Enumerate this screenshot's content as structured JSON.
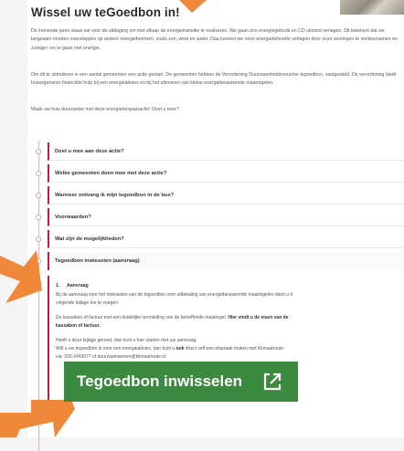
{
  "page": {
    "title": "Wissel uw teGoedbon in!",
    "intro": "De komende jaren staan we voor de uitdaging om met elkaar de energietransitie te realiseren. We gaan ons energiegebruik en CO uitstoot verlagen. Dit betekent dat we langzaam moeten overstappen op andere energiebronnen, zoals zon, wind en water. Daa kunnen we onze energiebehoefte verlagen door onze woningen te verduurzamen en zuiniger om te gaan met energie.",
    "paragraph2": "Om dit te stimuleren is een aantal gemeenten een actie gestart. De gemeenten hebben de Verordening Duurzaamheidsvoucher tegoedbon, vastgesteld. De verordening biedt huiseigenaren financiële hulp bij een energieadvies en bij het uitvoeren van kleine energiebesparende maatregelen.",
    "paragraph3": "Maak uw huis duurzamer met deze energiebespaaractie! Doet u mee?"
  },
  "accordion": {
    "items": [
      {
        "label": "Doet u mee aan deze actie?"
      },
      {
        "label": "Welke gemeenten doen mee met deze actie?"
      },
      {
        "label": "Wanneer ontvang ik mijn tegoedbon in de bus?"
      },
      {
        "label": "Voorwaarden?"
      },
      {
        "label": "Wat zijn de mogelijkheden?"
      },
      {
        "label": "Tegoedbon inwisselen (aanvraag)"
      }
    ],
    "open_panel": {
      "step_number": "1.",
      "step_title": "Aanvraag",
      "line1": "Bij de aanvraag voor het inwisselen van de tegoedbon voor uitbetaling van energiebesparende maatregelen dient u d",
      "line2": "volgende bijlage toe te voegen:",
      "line3_text": "De kassabon of factuur met een duidelijke vermelding van de betreffende maatregel.",
      "line3_link": "Hier vindt u de eisen van de",
      "line4_link": "kassabon of factuur.",
      "line5": "Heeft u deze bijlage gereed, dan kunt u hier starten met uw aanvraag.",
      "line6_pre": "Wilt u uw tegoedbon in voor een energieadvies, dan kunt u",
      "line6_bold": "ook",
      "line6_post": "direct zelf een afspraak maken met Klimaatroute",
      "line7": "via: 020-2443977 of duurzaamwonen@klimaatroute.nl."
    }
  },
  "cta": {
    "label": "Tegoedbon inwisselen",
    "icon": "external-link-icon",
    "color": "#3c8a3f"
  },
  "annotation_color": "#f0883a"
}
